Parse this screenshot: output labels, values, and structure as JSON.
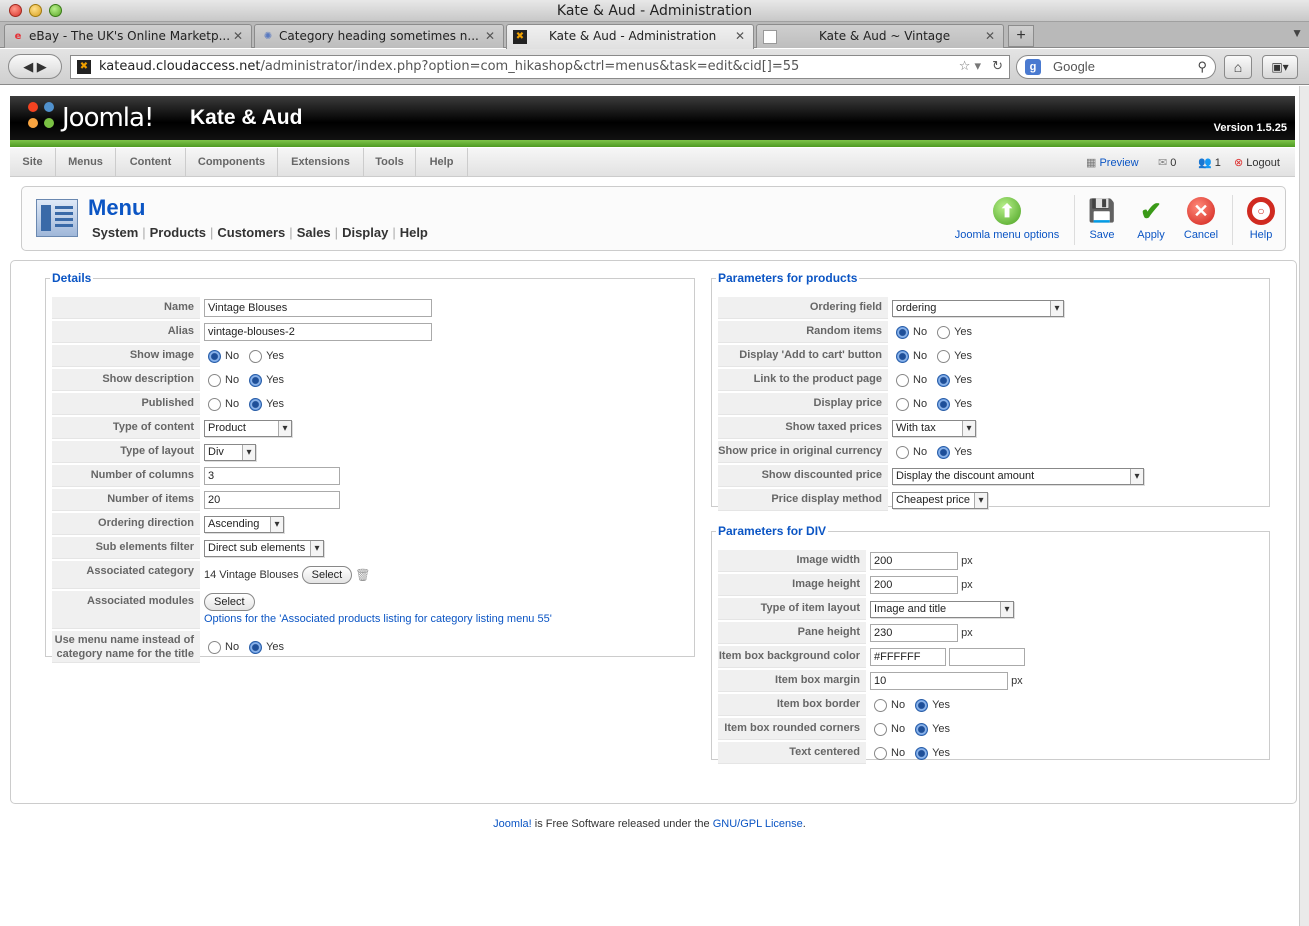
{
  "window": {
    "title": "Kate & Aud - Administration"
  },
  "tabs": [
    {
      "label": "eBay - The UK's Online Marketp...",
      "icon": "ebay-favicon"
    },
    {
      "label": "Category heading sometimes n...",
      "icon": "forum-favicon"
    },
    {
      "label": "Kate & Aud - Administration",
      "icon": "joomla-favicon",
      "active": true
    },
    {
      "label": "Kate & Aud ~ Vintage",
      "icon": "page-favicon"
    }
  ],
  "address": {
    "host": "kateaud.cloudaccess.net",
    "path": "/administrator/index.php?option=com_hikashop&ctrl=menus&task=edit&cid[]=55"
  },
  "search": {
    "placeholder": "Google"
  },
  "header": {
    "logo": "Joomla!",
    "site_name": "Kate & Aud",
    "version": "Version 1.5.25"
  },
  "main_menu": [
    "Site",
    "Menus",
    "Content",
    "Components",
    "Extensions",
    "Tools",
    "Help"
  ],
  "status": {
    "preview": "Preview",
    "messages": "0",
    "users": "1",
    "logout": "Logout"
  },
  "page": {
    "title": "Menu",
    "submenu": [
      "System",
      "Products",
      "Customers",
      "Sales",
      "Display",
      "Help"
    ]
  },
  "toolbar": {
    "joomla_options": "Joomla menu options",
    "save": "Save",
    "apply": "Apply",
    "cancel": "Cancel",
    "help": "Help"
  },
  "details": {
    "legend": "Details",
    "name_label": "Name",
    "name_value": "Vintage Blouses",
    "alias_label": "Alias",
    "alias_value": "vintage-blouses-2",
    "show_image_label": "Show image",
    "show_description_label": "Show description",
    "published_label": "Published",
    "type_content_label": "Type of content",
    "type_content_value": "Product",
    "type_layout_label": "Type of layout",
    "type_layout_value": "Div",
    "columns_label": "Number of columns",
    "columns_value": "3",
    "items_label": "Number of items",
    "items_value": "20",
    "ordering_dir_label": "Ordering direction",
    "ordering_dir_value": "Ascending",
    "sub_filter_label": "Sub elements filter",
    "sub_filter_value": "Direct sub elements",
    "assoc_category_label": "Associated category",
    "assoc_category_value": "14 Vintage Blouses",
    "assoc_modules_label": "Associated modules",
    "select_label": "Select",
    "options_link": "Options for the 'Associated products listing for category listing menu 55'",
    "use_menu_name_label_1": "Use menu name instead of",
    "use_menu_name_label_2": "category name for the title",
    "no": "No",
    "yes": "Yes"
  },
  "products_params": {
    "legend": "Parameters for products",
    "ordering_field_label": "Ordering field",
    "ordering_field_value": "ordering",
    "random_items_label": "Random items",
    "add_to_cart_label": "Display 'Add to cart' button",
    "link_product_label": "Link to the product page",
    "display_price_label": "Display price",
    "show_taxed_label": "Show taxed prices",
    "show_taxed_value": "With tax",
    "original_currency_label": "Show price in original currency",
    "discounted_label": "Show discounted price",
    "discounted_value": "Display the discount amount",
    "price_method_label": "Price display method",
    "price_method_value": "Cheapest price"
  },
  "div_params": {
    "legend": "Parameters for DIV",
    "image_width_label": "Image width",
    "image_width_value": "200",
    "image_height_label": "Image height",
    "image_height_value": "200",
    "item_layout_label": "Type of item layout",
    "item_layout_value": "Image and title",
    "pane_height_label": "Pane height",
    "pane_height_value": "230",
    "bg_color_label": "Item box background color",
    "bg_color_value": "#FFFFFF",
    "margin_label": "Item box margin",
    "margin_value": "10",
    "border_label": "Item box border",
    "rounded_label": "Item box rounded corners",
    "centered_label": "Text centered",
    "px": "px"
  },
  "footer": {
    "joomla": "Joomla!",
    "middle": " is Free Software released under the ",
    "license": "GNU/GPL License",
    "end": "."
  },
  "colors": {
    "accent": "#0b55c4",
    "green": "#5aa628"
  }
}
